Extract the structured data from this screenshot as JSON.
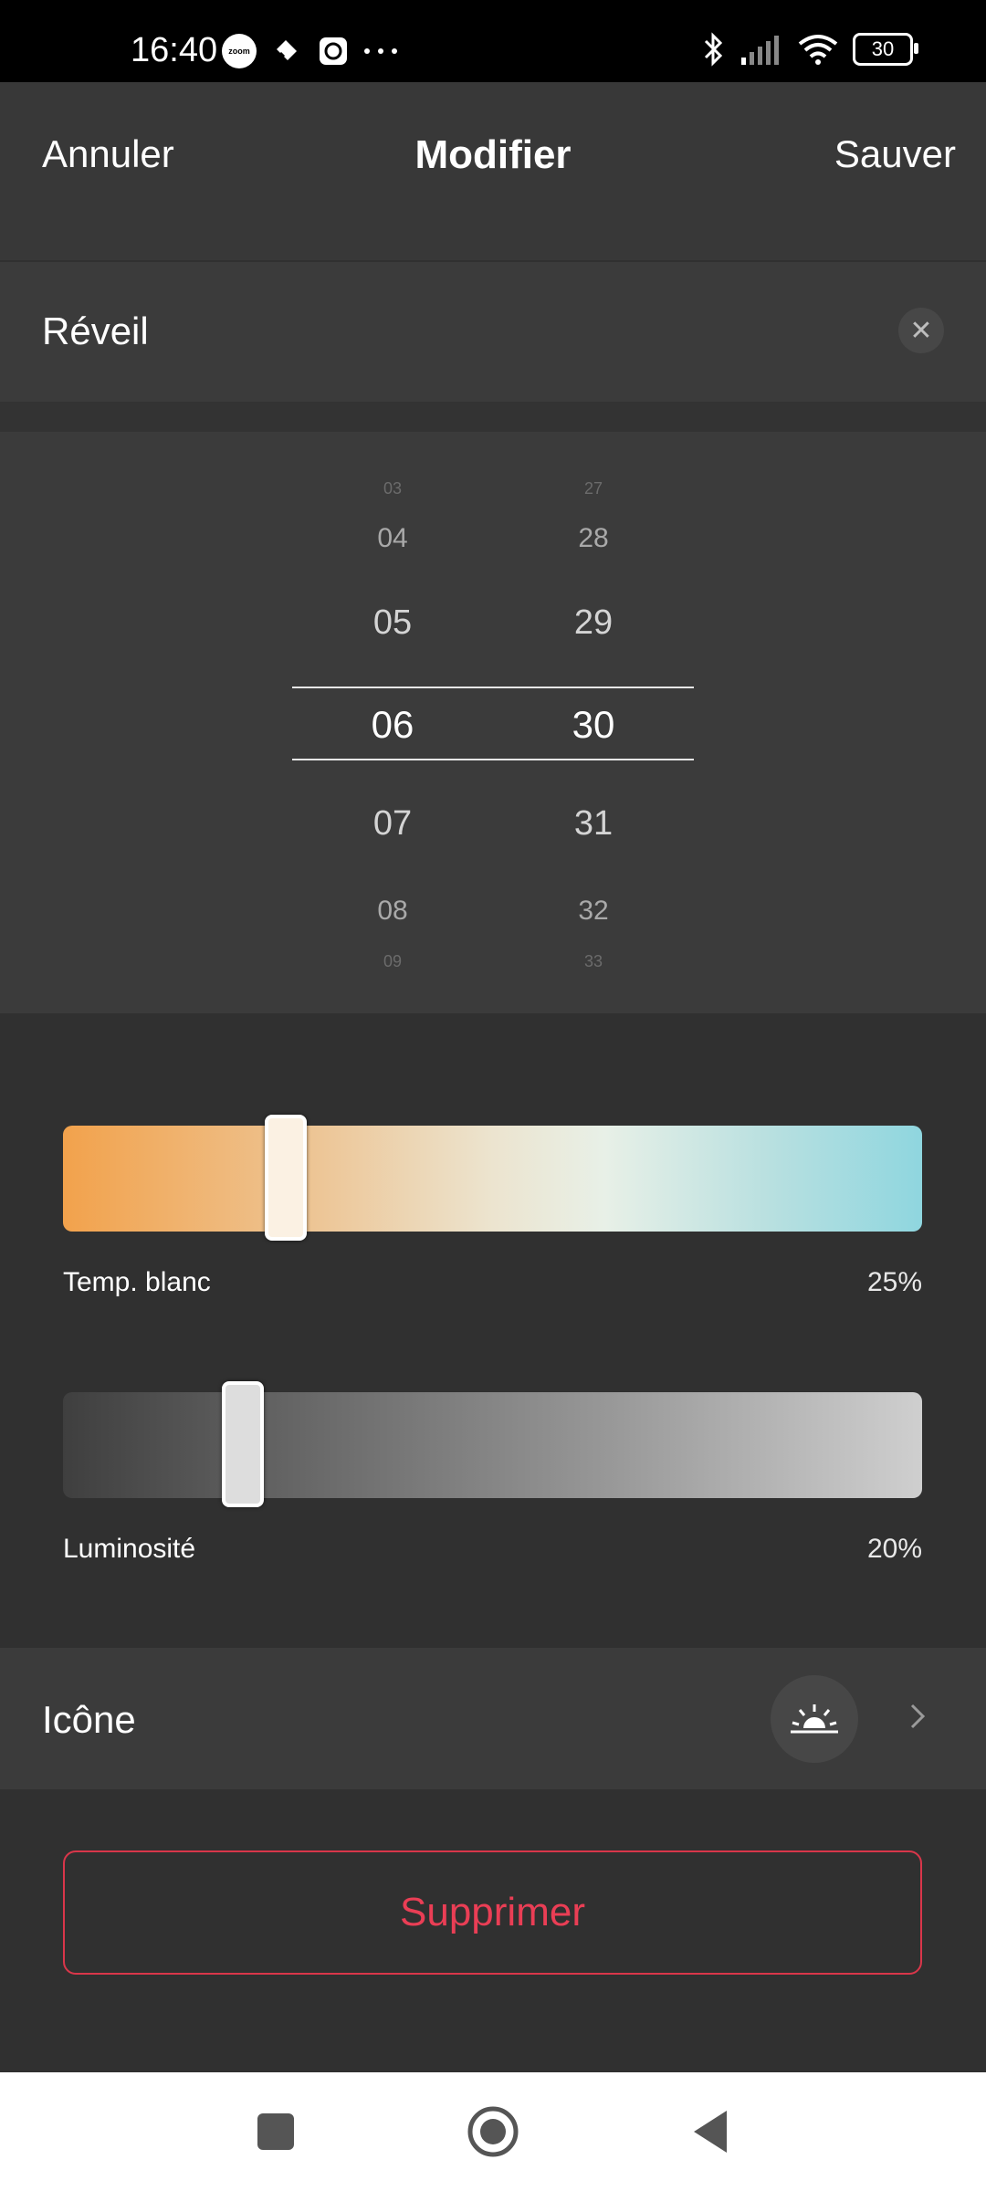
{
  "status_bar": {
    "time": "16:40",
    "zoom_badge": "zoom",
    "battery": "30",
    "icons": [
      "zoom-icon",
      "app-icon",
      "screen-record-icon",
      "more-dots-icon",
      "bluetooth-icon",
      "signal-icon",
      "wifi-icon",
      "battery-icon"
    ]
  },
  "header": {
    "cancel": "Annuler",
    "title": "Modifier",
    "save": "Sauver"
  },
  "name": {
    "value": "Réveil",
    "clear_icon": "close-icon"
  },
  "time_picker": {
    "hours": [
      "03",
      "04",
      "05",
      "06",
      "07",
      "08",
      "09"
    ],
    "minutes": [
      "27",
      "28",
      "29",
      "30",
      "31",
      "32",
      "33"
    ],
    "selected_hour": "06",
    "selected_minute": "30"
  },
  "white_temperature": {
    "label": "Temp. blanc",
    "value_text": "25%",
    "value": 0.25,
    "gradient_colors": [
      "#f2a24c",
      "#ece4cf",
      "#8fd6df"
    ]
  },
  "brightness": {
    "label": "Luminosité",
    "value_text": "20%",
    "value": 0.2,
    "gradient_colors": [
      "#3f3f3f",
      "#cfcfcf"
    ]
  },
  "icon_setting": {
    "label": "Icône",
    "selected_icon": "sunrise-icon",
    "chevron_icon": "chevron-right-icon"
  },
  "delete": {
    "label": "Supprimer",
    "color": "#ea3e55"
  },
  "nav_bar": {
    "icons": [
      "recent-apps-icon",
      "home-icon",
      "back-icon"
    ]
  }
}
